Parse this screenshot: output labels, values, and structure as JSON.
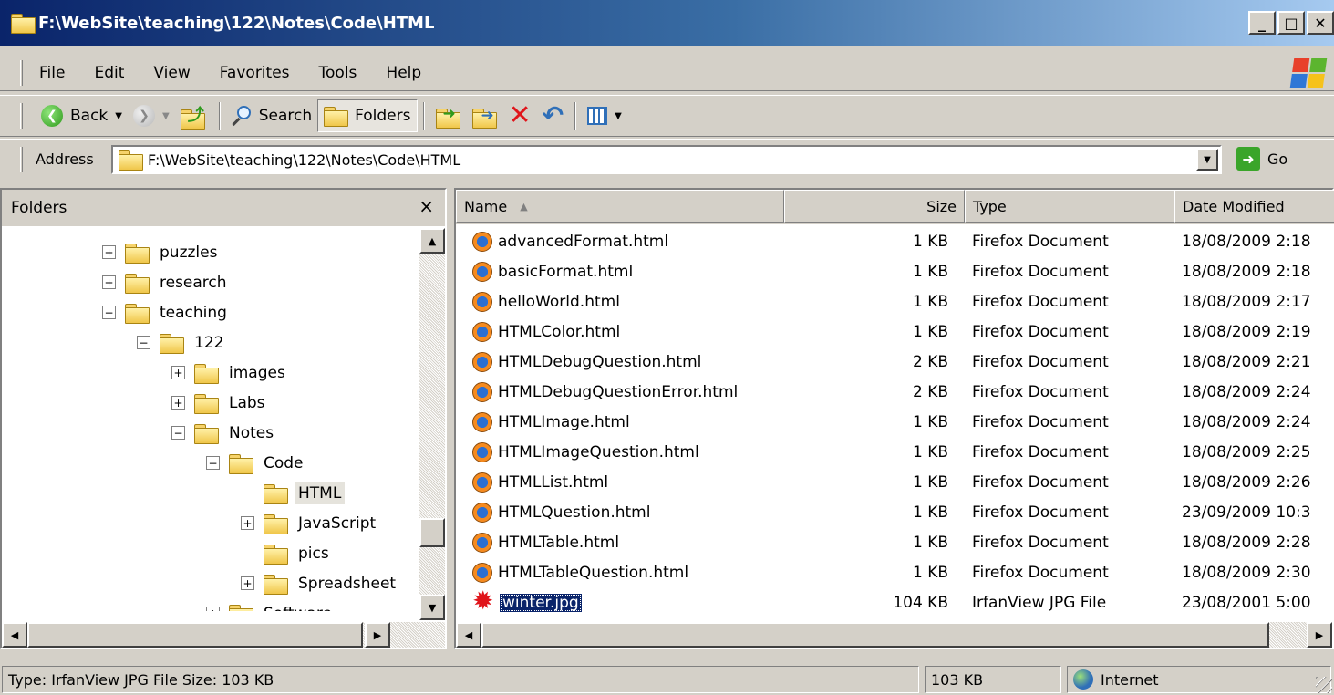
{
  "window": {
    "title": "F:\\WebSite\\teaching\\122\\Notes\\Code\\HTML",
    "minimize": "_",
    "maximize": "□",
    "close": "✕"
  },
  "menu": [
    "File",
    "Edit",
    "View",
    "Favorites",
    "Tools",
    "Help"
  ],
  "toolbar": {
    "back": "Back",
    "search": "Search",
    "folders": "Folders"
  },
  "address": {
    "label": "Address",
    "value": "F:\\WebSite\\teaching\\122\\Notes\\Code\\HTML",
    "go": "Go"
  },
  "folders_pane": {
    "title": "Folders",
    "close": "×",
    "tree": [
      {
        "label": "puzzles",
        "expander": "+"
      },
      {
        "label": "research",
        "expander": "+"
      },
      {
        "label": "teaching",
        "expander": "−"
      },
      {
        "label": "122",
        "expander": "−"
      },
      {
        "label": "images",
        "expander": "+"
      },
      {
        "label": "Labs",
        "expander": "+"
      },
      {
        "label": "Notes",
        "expander": "−"
      },
      {
        "label": "Code",
        "expander": "−"
      },
      {
        "label": "HTML",
        "expander": ""
      },
      {
        "label": "JavaScript",
        "expander": "+"
      },
      {
        "label": "pics",
        "expander": ""
      },
      {
        "label": "Spreadsheet",
        "expander": "+"
      },
      {
        "label": "Software",
        "expander": "+"
      }
    ]
  },
  "files_pane": {
    "columns": {
      "name": "Name",
      "size": "Size",
      "type": "Type",
      "date": "Date Modified"
    },
    "files": [
      {
        "name": "advancedFormat.html",
        "size": "1 KB",
        "type": "Firefox Document",
        "date": "18/08/2009 2:18"
      },
      {
        "name": "basicFormat.html",
        "size": "1 KB",
        "type": "Firefox Document",
        "date": "18/08/2009 2:18"
      },
      {
        "name": "helloWorld.html",
        "size": "1 KB",
        "type": "Firefox Document",
        "date": "18/08/2009 2:17"
      },
      {
        "name": "HTMLColor.html",
        "size": "1 KB",
        "type": "Firefox Document",
        "date": "18/08/2009 2:19"
      },
      {
        "name": "HTMLDebugQuestion.html",
        "size": "2 KB",
        "type": "Firefox Document",
        "date": "18/08/2009 2:21"
      },
      {
        "name": "HTMLDebugQuestionError.html",
        "size": "2 KB",
        "type": "Firefox Document",
        "date": "18/08/2009 2:24"
      },
      {
        "name": "HTMLImage.html",
        "size": "1 KB",
        "type": "Firefox Document",
        "date": "18/08/2009 2:24"
      },
      {
        "name": "HTMLImageQuestion.html",
        "size": "1 KB",
        "type": "Firefox Document",
        "date": "18/08/2009 2:25"
      },
      {
        "name": "HTMLList.html",
        "size": "1 KB",
        "type": "Firefox Document",
        "date": "18/08/2009 2:26"
      },
      {
        "name": "HTMLQuestion.html",
        "size": "1 KB",
        "type": "Firefox Document",
        "date": "23/09/2009 10:3"
      },
      {
        "name": "HTMLTable.html",
        "size": "1 KB",
        "type": "Firefox Document",
        "date": "18/08/2009 2:28"
      },
      {
        "name": "HTMLTableQuestion.html",
        "size": "1 KB",
        "type": "Firefox Document",
        "date": "18/08/2009 2:30"
      },
      {
        "name": "winter.jpg",
        "size": "104 KB",
        "type": "IrfanView JPG File",
        "date": "23/08/2001 5:00"
      }
    ]
  },
  "status": {
    "info": "Type: IrfanView JPG File Size: 103 KB",
    "size": "103 KB",
    "zone": "Internet"
  },
  "colors": {
    "selection": "#0a246a",
    "chrome": "#d4d0c8"
  }
}
